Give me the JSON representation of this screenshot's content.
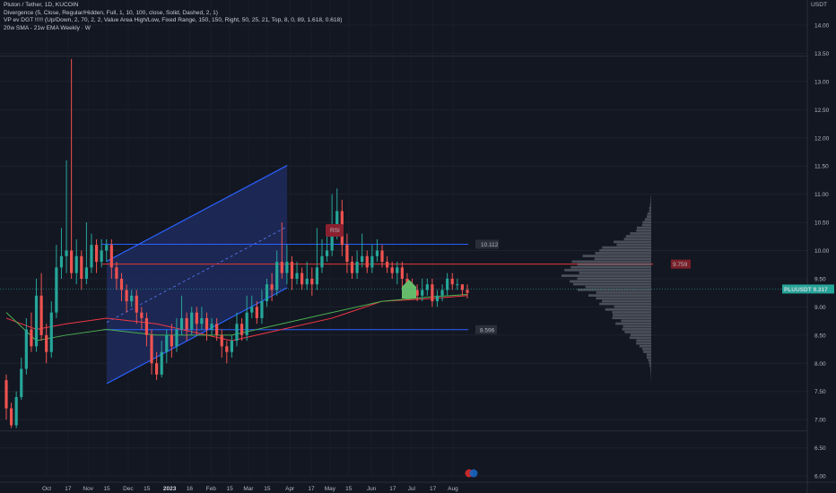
{
  "legend": {
    "title": "Pluton / Tether, 1D, KUCOIN",
    "line2": "Divergence (5, Close, Regular/Hidden, Full, 1, 10, 100, close, Solid, Dashed, 2, 1)",
    "line3": "VP ev DGT !!!!! (Up/Down, 2, 70, 2, 2, Value Area High/Low, Fixed Range, 150, 150, Right, 50, 25, 21, Top, 8, 0, 89, 1.618, 0.618)",
    "line4": "20w SMA - 21w EMA Weekly · W"
  },
  "price_unit": "USDT",
  "colors": {
    "background": "#131722",
    "up": "#26a69a",
    "down": "#ef5350",
    "channel": "#2962ff",
    "channel_fill": "#1e2a5c",
    "level_line": "#2962ff",
    "poc_line": "#e53935",
    "sma": "#f23645",
    "ema": "#4caf50",
    "volume_profile": "#787b86"
  },
  "chart_data": {
    "type": "candlestick",
    "symbol": "Pluton / Tether",
    "timeframe": "1D",
    "exchange": "KUCOIN",
    "y_axis_ticks": [
      6.0,
      6.5,
      7.0,
      7.5,
      8.0,
      8.5,
      9.0,
      9.5,
      10.0,
      10.5,
      11.0,
      11.5,
      12.0,
      12.5,
      13.0,
      13.5,
      14.0
    ],
    "x_axis_ticks": [
      "Oct",
      "17",
      "Nov",
      "15",
      "Dec",
      "15",
      "2023",
      "16",
      "Feb",
      "15",
      "Mar",
      "15",
      "Apr",
      "17",
      "May",
      "15",
      "Jun",
      "17",
      "Jul",
      "17",
      "Aug"
    ],
    "y_range": [
      5.95,
      14.3
    ],
    "last_price_label": "PLUUSDT",
    "last_price": "9.317",
    "poc_price": "9.759",
    "levels": [
      {
        "label": "10.112",
        "price": 10.112
      },
      {
        "label": "8.596",
        "price": 8.596
      },
      {
        "label": "",
        "price": 9.759,
        "kind": "poc"
      }
    ],
    "annotation": "RSI",
    "channel": {
      "upper_start": {
        "date": "2022-11-15",
        "price": 9.81
      },
      "upper_end": {
        "date": "2023-03-30",
        "price": 11.51
      },
      "lower_start": {
        "date": "2022-11-15",
        "price": 7.64
      },
      "lower_end": {
        "date": "2023-03-30",
        "price": 9.34
      }
    },
    "candles": [
      [
        7.7,
        7.2,
        7.8,
        7.0
      ],
      [
        7.2,
        6.9,
        7.3,
        6.85
      ],
      [
        6.9,
        7.4,
        7.5,
        6.85
      ],
      [
        7.4,
        7.9,
        8.1,
        7.35
      ],
      [
        7.9,
        8.6,
        8.8,
        7.8
      ],
      [
        8.6,
        8.3,
        8.9,
        8.2
      ],
      [
        8.3,
        9.2,
        9.5,
        8.2
      ],
      [
        9.2,
        8.5,
        9.6,
        8.4
      ],
      [
        8.5,
        8.2,
        8.7,
        8.0
      ],
      [
        8.2,
        8.9,
        9.1,
        8.1
      ],
      [
        8.9,
        9.7,
        10.1,
        8.8
      ],
      [
        9.7,
        9.9,
        10.4,
        9.5
      ],
      [
        9.9,
        10.0,
        11.6,
        9.6
      ],
      [
        10.0,
        9.6,
        13.4,
        9.5
      ],
      [
        9.6,
        9.9,
        10.2,
        9.4
      ],
      [
        9.9,
        9.5,
        10.0,
        9.3
      ],
      [
        9.5,
        9.7,
        10.5,
        9.4
      ],
      [
        9.7,
        10.1,
        10.3,
        9.6
      ],
      [
        10.1,
        9.8,
        10.2,
        9.6
      ],
      [
        9.8,
        10.0,
        10.2,
        9.7
      ],
      [
        10.0,
        10.1,
        10.2,
        9.8
      ],
      [
        10.1,
        9.7,
        10.2,
        9.5
      ],
      [
        9.7,
        9.5,
        9.8,
        9.3
      ],
      [
        9.5,
        9.3,
        9.6,
        9.1
      ],
      [
        9.3,
        9.1,
        9.4,
        8.9
      ],
      [
        9.1,
        9.2,
        9.3,
        9.0
      ],
      [
        9.2,
        8.9,
        9.3,
        8.7
      ],
      [
        8.9,
        8.8,
        9.0,
        8.6
      ],
      [
        8.8,
        8.5,
        8.9,
        8.3
      ],
      [
        8.5,
        8.0,
        8.6,
        7.8
      ],
      [
        8.0,
        7.8,
        8.2,
        7.7
      ],
      [
        7.8,
        8.2,
        8.4,
        7.75
      ],
      [
        8.2,
        8.5,
        8.6,
        8.0
      ],
      [
        8.5,
        8.3,
        8.7,
        8.1
      ],
      [
        8.3,
        8.6,
        8.8,
        8.2
      ],
      [
        8.6,
        8.8,
        9.2,
        8.5
      ],
      [
        8.8,
        8.6,
        8.9,
        8.4
      ],
      [
        8.6,
        8.9,
        9.0,
        8.5
      ],
      [
        8.9,
        8.7,
        9.0,
        8.5
      ],
      [
        8.7,
        8.8,
        9.0,
        8.6
      ],
      [
        8.8,
        8.6,
        8.9,
        8.4
      ],
      [
        8.6,
        8.7,
        8.8,
        8.5
      ],
      [
        8.7,
        8.5,
        8.8,
        8.4
      ],
      [
        8.5,
        8.3,
        8.6,
        8.1
      ],
      [
        8.3,
        8.2,
        8.4,
        8.0
      ],
      [
        8.2,
        8.4,
        8.5,
        8.1
      ],
      [
        8.4,
        8.7,
        8.9,
        8.3
      ],
      [
        8.7,
        8.5,
        8.8,
        8.4
      ],
      [
        8.5,
        8.9,
        9.2,
        8.4
      ],
      [
        8.9,
        9.0,
        9.2,
        8.8
      ],
      [
        9.0,
        8.8,
        9.1,
        8.7
      ],
      [
        8.8,
        9.1,
        9.3,
        8.7
      ],
      [
        9.1,
        9.4,
        9.5,
        9.0
      ],
      [
        9.4,
        9.3,
        9.6,
        9.1
      ],
      [
        9.3,
        9.8,
        10.0,
        9.2
      ],
      [
        9.8,
        9.6,
        10.5,
        9.5
      ],
      [
        9.6,
        9.8,
        10.1,
        9.4
      ],
      [
        9.8,
        9.5,
        9.9,
        9.3
      ],
      [
        9.5,
        9.6,
        9.8,
        9.4
      ],
      [
        9.6,
        9.4,
        9.7,
        9.3
      ],
      [
        9.4,
        9.5,
        9.8,
        9.3
      ],
      [
        9.5,
        9.4,
        9.7,
        9.2
      ],
      [
        9.4,
        9.7,
        10.4,
        9.3
      ],
      [
        9.7,
        9.9,
        10.2,
        9.6
      ],
      [
        9.9,
        10.0,
        10.4,
        9.8
      ],
      [
        10.0,
        10.4,
        11.0,
        9.9
      ],
      [
        10.4,
        10.7,
        11.1,
        10.2
      ],
      [
        10.7,
        10.1,
        10.9,
        9.9
      ],
      [
        10.1,
        9.8,
        10.3,
        9.6
      ],
      [
        9.8,
        9.6,
        9.9,
        9.5
      ],
      [
        9.6,
        9.8,
        10.0,
        9.5
      ],
      [
        9.8,
        9.9,
        10.3,
        9.7
      ],
      [
        9.9,
        9.7,
        10.0,
        9.6
      ],
      [
        9.7,
        9.9,
        10.1,
        9.6
      ],
      [
        9.9,
        10.0,
        10.2,
        9.8
      ],
      [
        10.0,
        9.8,
        10.1,
        9.7
      ],
      [
        9.8,
        9.7,
        9.9,
        9.6
      ],
      [
        9.7,
        9.6,
        9.8,
        9.5
      ],
      [
        9.6,
        9.7,
        9.8,
        9.4
      ],
      [
        9.7,
        9.5,
        9.8,
        9.3
      ],
      [
        9.5,
        9.4,
        9.6,
        9.3
      ],
      [
        9.4,
        9.3,
        9.5,
        9.2
      ],
      [
        9.3,
        9.2,
        9.4,
        9.1
      ],
      [
        9.2,
        9.3,
        9.5,
        9.1
      ],
      [
        9.3,
        9.4,
        9.5,
        9.2
      ],
      [
        9.4,
        9.1,
        9.5,
        9.0
      ],
      [
        9.1,
        9.2,
        9.3,
        9.0
      ],
      [
        9.2,
        9.3,
        9.4,
        9.1
      ],
      [
        9.3,
        9.5,
        9.6,
        9.2
      ],
      [
        9.5,
        9.4,
        9.6,
        9.3
      ],
      [
        9.4,
        9.4,
        9.5,
        9.3
      ],
      [
        9.4,
        9.3,
        9.4,
        9.2
      ],
      [
        9.3,
        9.25,
        9.4,
        9.15
      ]
    ],
    "sma_points": [
      [
        0,
        8.8
      ],
      [
        6,
        8.6
      ],
      [
        12,
        8.7
      ],
      [
        20,
        8.8
      ],
      [
        30,
        8.7
      ],
      [
        45,
        8.4
      ],
      [
        55,
        8.6
      ],
      [
        65,
        8.8
      ],
      [
        75,
        9.1
      ],
      [
        85,
        9.15
      ],
      [
        92,
        9.2
      ]
    ],
    "ema_points": [
      [
        0,
        8.9
      ],
      [
        6,
        8.4
      ],
      [
        12,
        8.5
      ],
      [
        20,
        8.6
      ],
      [
        30,
        8.5
      ],
      [
        45,
        8.5
      ],
      [
        55,
        8.7
      ],
      [
        65,
        8.9
      ],
      [
        75,
        9.1
      ],
      [
        85,
        9.18
      ],
      [
        92,
        9.22
      ]
    ]
  }
}
